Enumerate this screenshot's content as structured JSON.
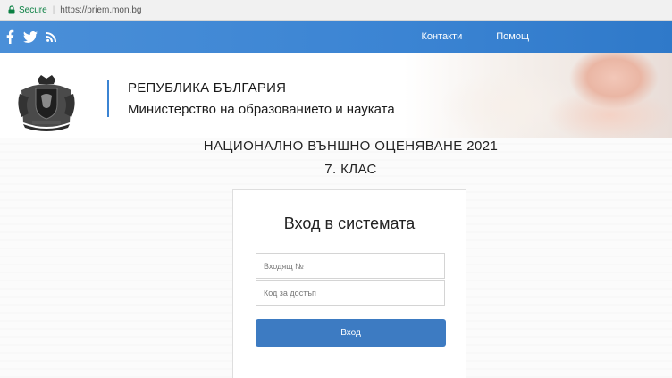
{
  "browser": {
    "secure_label": "Secure",
    "url": "https://priem.mon.bg"
  },
  "topbar": {
    "social_icons": [
      "facebook-icon",
      "twitter-icon",
      "rss-icon"
    ],
    "nav": {
      "contacts": "Контакти",
      "help": "Помощ"
    },
    "color": "#3b84d3"
  },
  "header": {
    "country": "РЕПУБЛИКА БЪЛГАРИЯ",
    "ministry": "Министерство на образованието и науката"
  },
  "exam": {
    "title": "НАЦИОНАЛНО ВЪНШНО ОЦЕНЯВАНЕ 2021",
    "class": "7. КЛАС"
  },
  "login": {
    "title": "Вход в системата",
    "incoming_number": {
      "placeholder": "Входящ №",
      "value": ""
    },
    "access_code": {
      "placeholder": "Код за достъп",
      "value": ""
    },
    "submit_label": "Вход",
    "button_color": "#3d7bc2"
  }
}
